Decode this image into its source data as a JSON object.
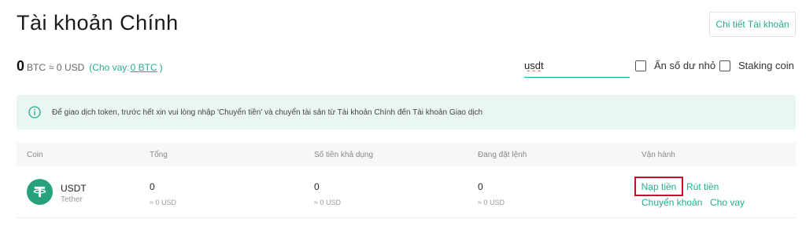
{
  "header": {
    "title": "Tài khoản Chính",
    "detail_button": "Chi tiết Tài khoản"
  },
  "balance": {
    "amount": "0",
    "unit": "BTC",
    "usd": "≈ 0 USD",
    "loan_prefix": "(Cho vay:",
    "loan_value": "0 BTC",
    "loan_suffix": ")"
  },
  "filters": {
    "search_value": "usdt",
    "hide_small_label": "Ẩn số dư nhỏ",
    "staking_label": "Staking coin"
  },
  "notice": {
    "icon": "info-icon",
    "text": "Để giao dịch token, trước hết xin vui lòng nhập 'Chuyển tiền' và chuyển tài sản từ Tài khoản Chính đến Tài khoản Giao dịch"
  },
  "table": {
    "columns": [
      "Coin",
      "Tổng",
      "Số tiền khả dụng",
      "Đang đặt lệnh",
      "Vận hành"
    ],
    "row": {
      "symbol": "USDT",
      "name": "Tether",
      "total": "0",
      "total_usd": "≈ 0 USD",
      "available": "0",
      "available_usd": "≈ 0 USD",
      "in_order": "0",
      "in_order_usd": "≈ 0 USD",
      "actions": {
        "deposit": "Nạp tiền",
        "withdraw": "Rút tiền",
        "transfer": "Chuyển khoản",
        "lend": "Cho vay"
      }
    }
  },
  "colors": {
    "accent": "#24ae8f",
    "notice_bg": "#e9f6f1",
    "tether": "#26a17b",
    "highlight_box": "#c8102e"
  }
}
